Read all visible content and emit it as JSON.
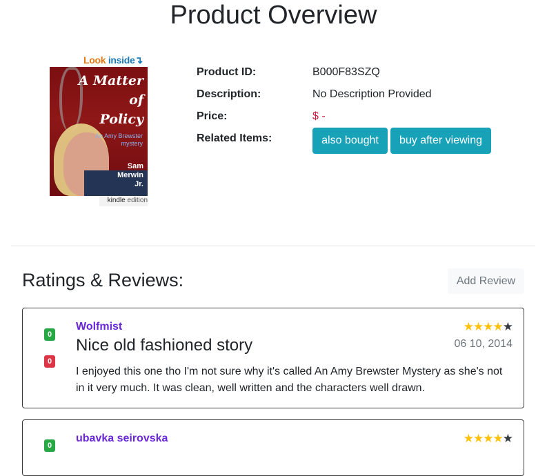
{
  "page": {
    "title": "Product Overview"
  },
  "cover": {
    "look": "Look",
    "inside": "inside",
    "arrow": "↵",
    "title_line1": "A Matter",
    "title_line2": "of",
    "title_line3": "Policy",
    "subtitle": "An Amy Brewster mystery",
    "author_line1": "Sam",
    "author_line2": "Merwin",
    "author_line3": "Jr.",
    "kindle": "kindle",
    "edition": "edition"
  },
  "product": {
    "id_label": "Product ID:",
    "id_value": "B000F83SZQ",
    "description_label": "Description:",
    "description_value": "No Description Provided",
    "price_label": "Price:",
    "price_value": "$ -",
    "related_label": "Related Items:",
    "related_buttons": [
      "also bought",
      "buy after viewing"
    ]
  },
  "reviews_section": {
    "title": "Ratings & Reviews:",
    "add_review": "Add Review"
  },
  "colors": {
    "accent": "#17a2b8",
    "upvote": "#28a745",
    "downvote": "#dc3545",
    "reviewer": "#6a27d8"
  },
  "reviews": [
    {
      "upvotes": "0",
      "downvotes": "0",
      "reviewer": "Wolfmist",
      "title": "Nice old fashioned story",
      "date": "06 10, 2014",
      "rating": 4,
      "text": "I enjoyed this one tho I'm not sure why it's called An Amy Brewster Mystery as she's not in it very much. It was clean, well written and the characters well drawn."
    },
    {
      "upvotes": "0",
      "downvotes": "",
      "reviewer": "ubavka seirovska",
      "title": "",
      "date": "",
      "rating": 4,
      "text": ""
    }
  ]
}
